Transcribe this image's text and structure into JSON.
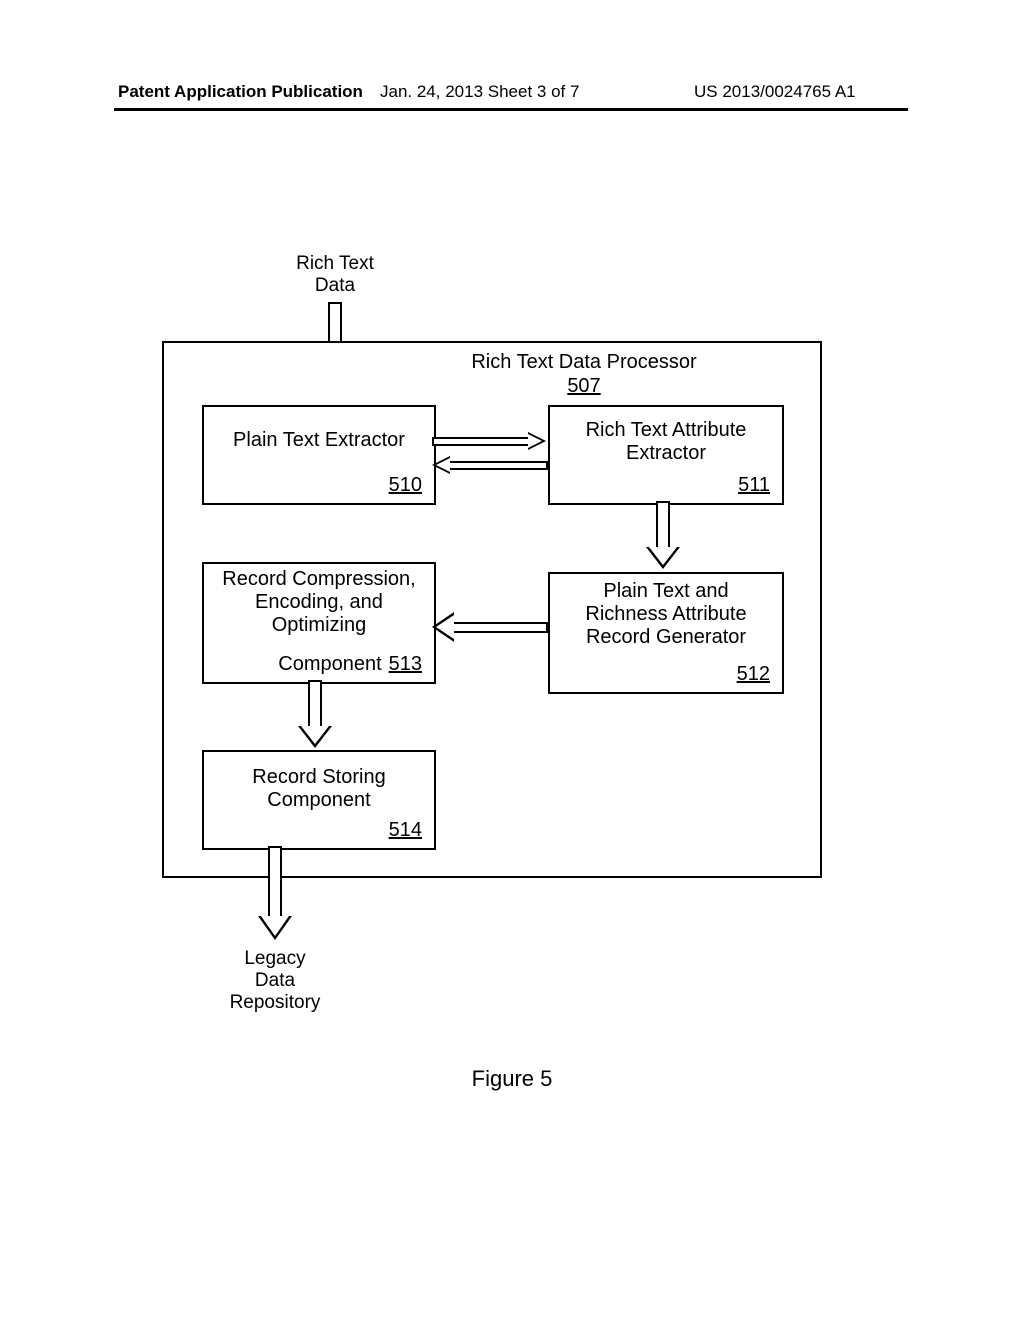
{
  "header": {
    "left": "Patent Application Publication",
    "mid": "Jan. 24, 2013  Sheet 3 of 7",
    "right": "US 2013/0024765 A1"
  },
  "labels": {
    "input_top1": "Rich Text",
    "input_top2": "Data",
    "output1": "Legacy",
    "output2": "Data",
    "output3": "Repository",
    "figure": "Figure 5"
  },
  "processor": {
    "title": "Rich Text Data Processor",
    "ref": "507"
  },
  "blocks": {
    "plain_extractor": {
      "line1": "Plain Text Extractor",
      "ref": "510"
    },
    "rich_attr": {
      "line1": "Rich Text Attribute",
      "line2": "Extractor",
      "ref": "511"
    },
    "record_gen": {
      "line1": "Plain Text and",
      "line2": "Richness Attribute",
      "line3": "Record Generator",
      "ref": "512"
    },
    "compress": {
      "line1": "Record Compression,",
      "line2": "Encoding, and",
      "line3": "Optimizing",
      "line4": "Component",
      "ref": "513"
    },
    "store": {
      "line1": "Record Storing",
      "line2": "Component",
      "ref": "514"
    }
  }
}
